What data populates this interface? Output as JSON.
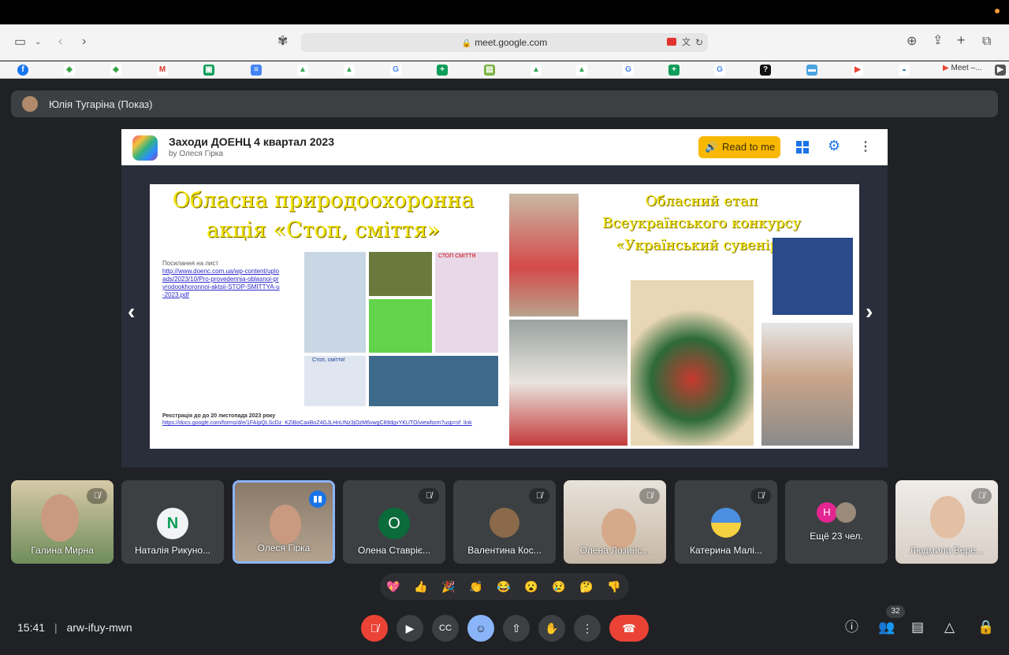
{
  "browser": {
    "url": "meet.google.com",
    "bookmark_tab": "Meet –..."
  },
  "presenter_bar": {
    "name": "Юлія Тугаріна (Показ)"
  },
  "shared_doc": {
    "title": "Заходи ДОЕНЦ 4 квартал 2023",
    "author": "by Олеся Гірка",
    "read_button": "Read to me"
  },
  "slide": {
    "left_title_1": "Обласна природоохоронна",
    "left_title_2": "акція «Стоп, сміття»",
    "link_label": "Посилання на лист",
    "link_url": "http://www.doenc.com.ua/wp-content/uploads/2023/10/Pro-provedennia-oblasnoi-pryrodookhoronnoi-aktsii-STOP-SMITTYA-u-2023.pdf",
    "reg_label": "Реєстрація до до 20 листопада 2023 року",
    "reg_url": "https://docs.google.com/forms/d/e/1FAIpQLScDz_KZiBoCaxBoZ4GJLHnUNz3jOzM6vwgC89dgvYKUTO/viewform?usp=sf_link",
    "collage_caption_1": "СТОП СМІТТЯ",
    "collage_caption_2": "Стоп, сміття!",
    "right_title_1": "Обласний етап",
    "right_title_2": "Всеукраїнського конкурсу",
    "right_title_3": "«Український сувенір»"
  },
  "participants": [
    {
      "name": "Галина Мирна"
    },
    {
      "name": "Наталія Рикуно...",
      "initial": "N"
    },
    {
      "name": "Олеся Гірка"
    },
    {
      "name": "Олена Ставріє...",
      "initial": "О"
    },
    {
      "name": "Валентина Кос..."
    },
    {
      "name": "Олена Лозинс..."
    },
    {
      "name": "Катерина Малі..."
    },
    {
      "name": "Ещё 23 чел.",
      "initial": "Н"
    },
    {
      "name": "Людмила Вере..."
    }
  ],
  "reactions": [
    "💖",
    "👍",
    "🎉",
    "👏",
    "😂",
    "😮",
    "😢",
    "🤔",
    "👎"
  ],
  "meeting": {
    "time": "15:41",
    "separator": "|",
    "code": "arw-ifuy-mwn",
    "participant_count": "32"
  },
  "colors": {
    "meet_bg": "#202124",
    "tile_bg": "#3c4043",
    "accent_blue": "#8ab4f8",
    "end_red": "#ea4335",
    "read_yellow": "#f9b800"
  }
}
